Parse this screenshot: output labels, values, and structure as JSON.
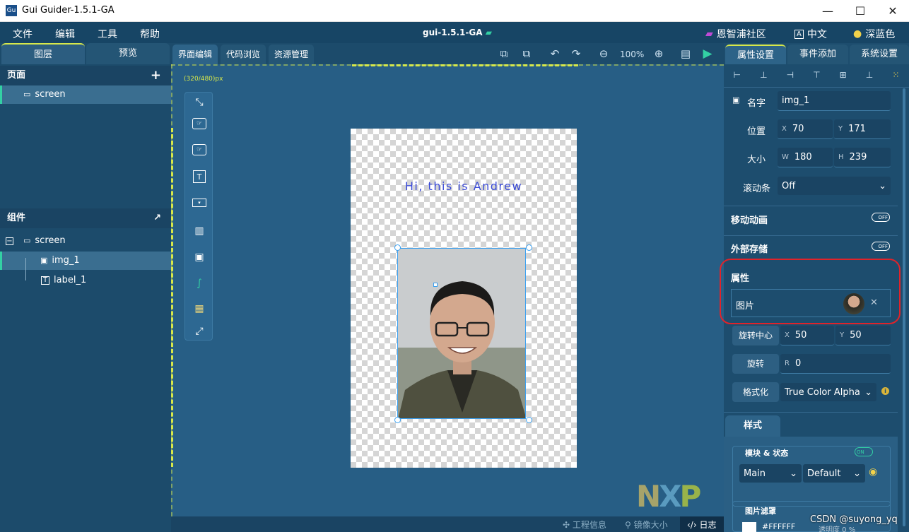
{
  "window": {
    "title": "Gui Guider-1.5.1-GA",
    "minimize": "—",
    "maximize": "☐",
    "close": "✕"
  },
  "menubar": {
    "items": [
      "文件",
      "编辑",
      "工具",
      "帮助"
    ],
    "project_name": "gui-1.5.1-GA",
    "community": "恩智浦社区",
    "language": "中文",
    "theme": "深蓝色"
  },
  "left_panel": {
    "tabs": [
      "图层",
      "预览"
    ],
    "pages_header": "页面",
    "pages": [
      "screen"
    ],
    "components_header": "组件",
    "tree": {
      "root": "screen",
      "children": [
        "img_1",
        "label_1"
      ]
    }
  },
  "center": {
    "tabs": [
      "界面编辑",
      "代码浏览",
      "资源管理"
    ],
    "zoom": "100%",
    "resolution": "(320/480)px",
    "label_text": "Hi, this is Andrew",
    "status": {
      "project_info": "工程信息",
      "mirror_size": "镜像大小",
      "log": "日志"
    },
    "watermark": "NXP"
  },
  "right_panel": {
    "tabs": [
      "属性设置",
      "事件添加",
      "系统设置"
    ],
    "name_label": "名字",
    "name_value": "img_1",
    "position_label": "位置",
    "pos_x": "70",
    "pos_y": "171",
    "size_label": "大小",
    "size_w": "180",
    "size_h": "239",
    "scrollbar_label": "滚动条",
    "scrollbar_value": "Off",
    "animation_label": "移动动画",
    "storage_label": "外部存储",
    "toggle_off": "OFF",
    "toggle_on": "ON",
    "attributes_header": "属性",
    "image_label": "图片",
    "pivot_label": "旋转中心",
    "pivot_x": "50",
    "pivot_y": "50",
    "rotate_label": "旋转",
    "rotate_value": "0",
    "format_label": "格式化",
    "format_value": "True Color Alpha",
    "style_tab": "样式",
    "part_state_label": "模块 & 状态",
    "part_value": "Main",
    "state_value": "Default",
    "recolor_label": "图片滤罩",
    "recolor_color": "#FFFFFF",
    "opacity_text": "透明度 0 %"
  },
  "watermark_text": "CSDN @suyong_yq",
  "colors": {
    "accent_yellow": "#d7e84a",
    "accent_green": "#33d0a4",
    "highlight_red": "#e0232a",
    "label_blue": "#3a4ad6"
  }
}
